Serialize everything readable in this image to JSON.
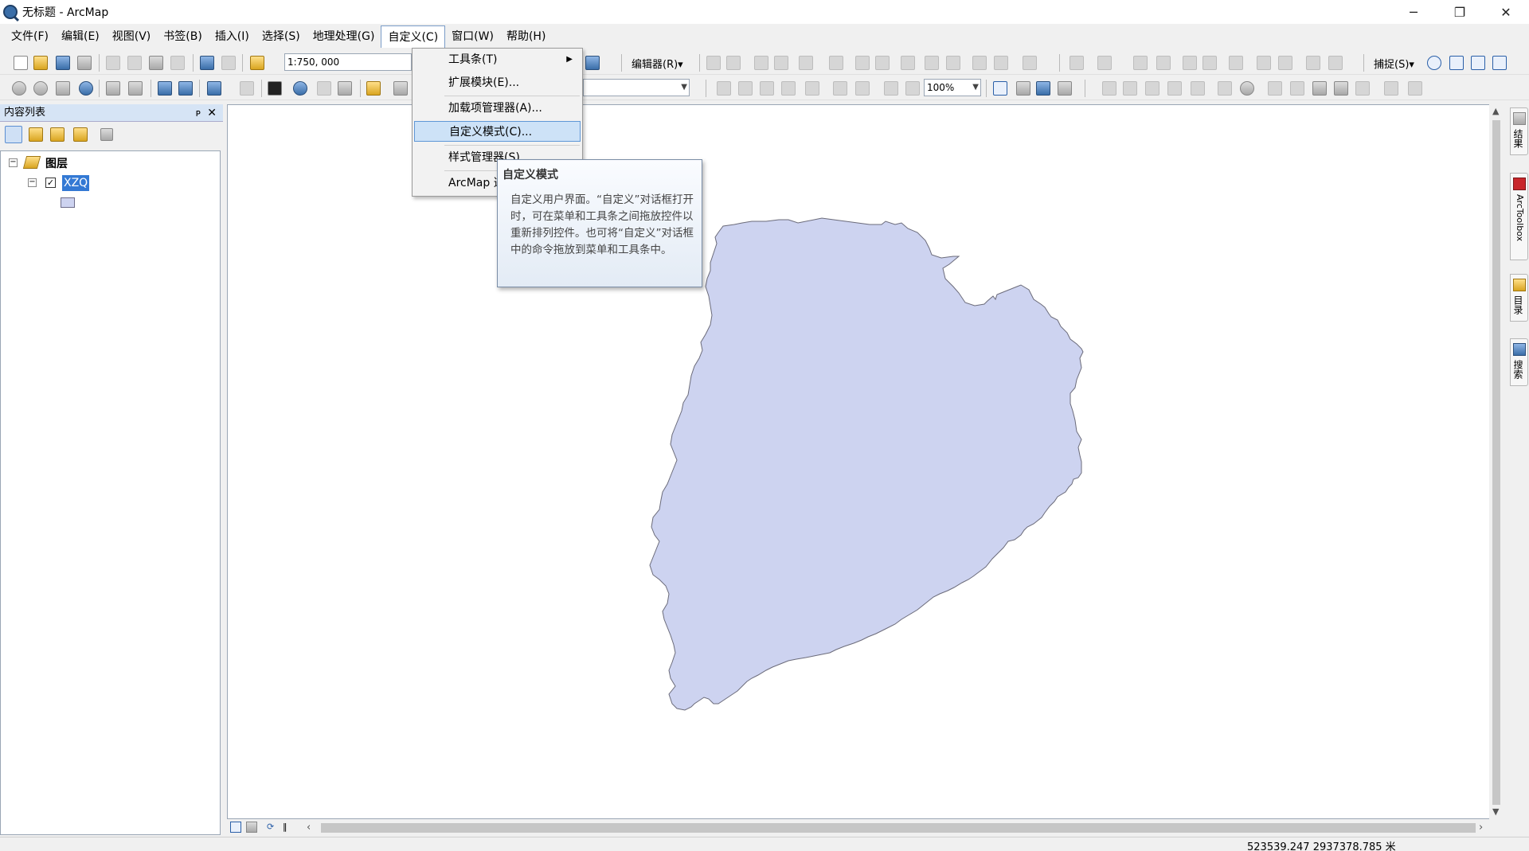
{
  "window": {
    "title": "无标题 - ArcMap",
    "controls": [
      "─",
      "❐",
      "✕"
    ]
  },
  "menubar": {
    "items": [
      "文件(F)",
      "编辑(E)",
      "视图(V)",
      "书签(B)",
      "插入(I)",
      "选择(S)",
      "地理处理(G)",
      "自定义(C)",
      "窗口(W)",
      "帮助(H)"
    ],
    "active": "自定义(C)"
  },
  "toolbar": {
    "scale": "1:750, 000",
    "editor_label": "编辑器(R)▾",
    "zoom": "100%",
    "snapping_label": "捕捉(S)▾"
  },
  "customize_menu": {
    "items": [
      {
        "label": "工具条(T)",
        "submenu": true
      },
      {
        "label": "扩展模块(E)..."
      },
      {
        "label": "加载项管理器(A)..."
      },
      {
        "label": "自定义模式(C)...",
        "highlighted": true
      },
      {
        "label": "样式管理器(S)..."
      },
      {
        "label": "ArcMap 选项(O)..."
      }
    ]
  },
  "tooltip": {
    "title": "自定义模式",
    "body": "自定义用户界面。“自定义”对话框打开时，可在菜单和工具条之间拖放控件以重新排列控件。也可将“自定义”对话框中的命令拖放到菜单和工具条中。"
  },
  "toc": {
    "title": "内容列表",
    "pin": "ᴘ",
    "close": "✕",
    "root_label": "图层",
    "layer_label": "XZQ",
    "polygon_fill": "#cdd3f0"
  },
  "status": {
    "coordinates": "523539.247  2937378.785 米"
  },
  "right_dock": {
    "tabs": [
      "结果",
      "ArcToolbox",
      "目录",
      "搜索"
    ]
  },
  "colors": {
    "selection_blue": "#3379d4",
    "menu_highlight": "#cde2f7",
    "polygon_fill": "#cdd3f0",
    "polygon_stroke": "#6b6b7a"
  }
}
